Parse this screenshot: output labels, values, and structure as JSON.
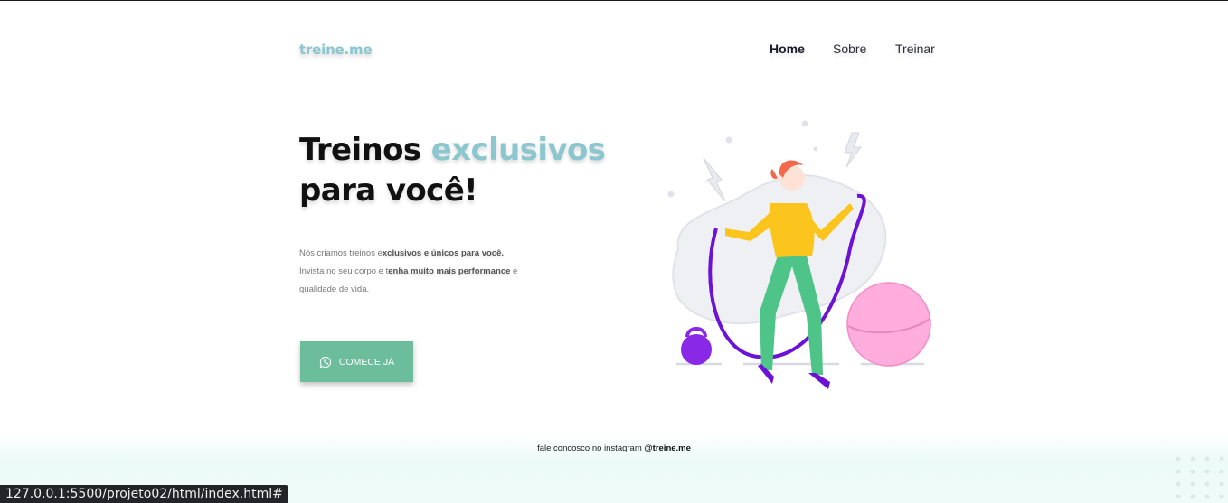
{
  "brand": {
    "logo": "treine.me"
  },
  "nav": {
    "items": [
      {
        "label": "Home",
        "active": true
      },
      {
        "label": "Sobre",
        "active": false
      },
      {
        "label": "Treinar",
        "active": false
      }
    ]
  },
  "hero": {
    "title_part1": "Treinos ",
    "title_accent": "exclusivos",
    "title_line2": "para você!",
    "desc_1a": "Nós criamos treinos e",
    "desc_1b": "xclusivos e únicos para você.",
    "desc_2a": "Invista no seu corpo e t",
    "desc_2b": "enha muito mais performance",
    "desc_2c": " e",
    "desc_3": "qualidade de vida.",
    "cta_label": "COMECE JÁ",
    "cta_icon": "whatsapp-icon"
  },
  "footer": {
    "text": "fale concosco no instagram ",
    "handle": "@treine.me"
  },
  "statusbar": {
    "url": "127.0.0.1:5500/projeto02/html/index.html#"
  },
  "colors": {
    "accent": "#8cc6cf",
    "button": "#6bbd9c",
    "footer_bg": "#eefbf8"
  }
}
